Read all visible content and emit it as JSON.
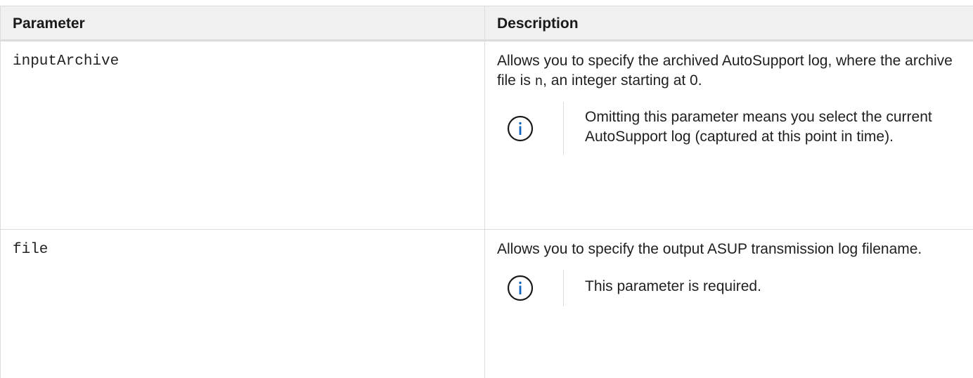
{
  "table": {
    "headers": {
      "parameter": "Parameter",
      "description": "Description"
    },
    "rows": [
      {
        "name": "inputArchive",
        "desc_before": "Allows you to specify the archived AutoSupport log, where the archive file is ",
        "desc_code": "n",
        "desc_after": ", an integer starting at 0.",
        "note": "Omitting this parameter means you select the current AutoSupport log (captured at this point in time).",
        "note_icon": "info-icon"
      },
      {
        "name": "file",
        "desc": "Allows you to specify the output ASUP transmission log filename.",
        "note": "This parameter is required.",
        "note_icon": "info-icon"
      }
    ]
  },
  "colors": {
    "info_icon": "#1565c0",
    "header_bg": "#f0f0f0",
    "border": "#dcdcdc"
  }
}
